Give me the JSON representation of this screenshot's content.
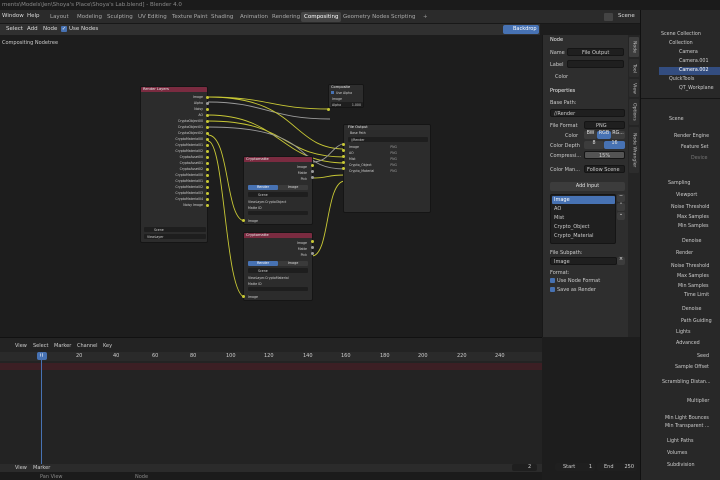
{
  "title_text": "ments\\Models\\Jen\\Shoya's Place\\Shoya's Lab.blend] - Blender 4.0",
  "menu": {
    "window": "Window",
    "help": "Help"
  },
  "workspaces": [
    "Layout",
    "Modeling",
    "Sculpting",
    "UV Editing",
    "Texture Paint",
    "Shading",
    "Animation",
    "Rendering",
    "Compositing",
    "Geometry Nodes",
    "Scripting"
  ],
  "scene_name": "Scene",
  "editor_header": {
    "select": "Select",
    "add": "Add",
    "node": "Node",
    "use_nodes": "Use Nodes",
    "backdrop": "Backdrop",
    "tree_label": "Compositing Nodetree"
  },
  "render_layers": {
    "title": "Render Layers",
    "outputs": [
      "Image",
      "Alpha",
      "Noisy",
      "AO",
      "CryptoObject00",
      "CryptoObject01",
      "CryptoObject02",
      "CryptoMaterial00",
      "CryptoMaterial01",
      "CryptoMaterial02",
      "CryptoAsset00",
      "CryptoAsset01",
      "CryptoAsset02",
      "CryptoMaterial00",
      "CryptoMaterial01",
      "CryptoMaterial02",
      "CryptoMaterial03",
      "CryptoMaterial04",
      "Noisy Image"
    ],
    "scene": "Scene",
    "view_layer": "ViewLayer"
  },
  "composite": {
    "title": "Composite",
    "use_alpha": "Use Alpha",
    "image": "Image",
    "alpha": "Alpha",
    "alpha_val": "1.000"
  },
  "file_output": {
    "title": "File Output",
    "base_path": "Base Path",
    "path_val": "//Render",
    "inputs": [
      "Image",
      "AO",
      "Mist",
      "Crypto_Object",
      "Crypto_Material"
    ],
    "png": "PNG"
  },
  "crypto_obj": {
    "title": "Cryptomatte",
    "outputs": [
      "Image",
      "Matte",
      "Pick"
    ],
    "render": "Render",
    "image_tab": "Image",
    "scene": "Scene",
    "layer": "ViewLayer.CryptoObject",
    "matte_id": "Matte ID",
    "input": "Image"
  },
  "crypto_mat": {
    "title": "Cryptomatte",
    "outputs": [
      "Image",
      "Matte",
      "Pick"
    ],
    "render": "Render",
    "image_tab": "Image",
    "scene": "Scene",
    "layer": "ViewLayer.CryptoMaterial",
    "matte_id": "Matte ID",
    "input": "Image"
  },
  "npanel": {
    "node_header": "Node",
    "name_label": "Name",
    "name_val": "File Output",
    "label_label": "Label",
    "color_label": "Color",
    "props_header": "Properties",
    "base_path_label": "Base Path:",
    "base_path_val": "//Render",
    "file_format_label": "File Format",
    "file_format_val": "PNG",
    "color_label2": "Color",
    "bw": "BW",
    "rgb": "RGB",
    "rgba": "RG...",
    "color_depth_label": "Color Depth",
    "depth_8": "8",
    "depth_16": "16",
    "compression_label": "Compressi...",
    "compression_val": "15%",
    "color_man_label": "Color Man...",
    "color_man_val": "Follow Scene",
    "add_input": "Add Input",
    "inputs": [
      "Image",
      "AO",
      "Mist",
      "Crypto_Object",
      "Crypto_Material"
    ],
    "file_subpath_label": "File Subpath:",
    "file_subpath_val": "Image",
    "format_label": "Format:",
    "use_node_format": "Use Node Format",
    "save_as_render": "Save as Render"
  },
  "side_tabs": [
    "Node",
    "Tool",
    "View",
    "Options",
    "Node Wrangler"
  ],
  "outliner": {
    "scene_collection": "Scene Collection",
    "items": [
      "Collection",
      "Camera",
      "Camera.001",
      "Camera.002",
      "QuickTools",
      "QT_Workplane"
    ]
  },
  "properties": {
    "scene": "Scene",
    "render_engine": "Render Engine",
    "feature_set": "Feature Set",
    "device": "Device",
    "sampling": "Sampling",
    "viewport": "Viewport",
    "noise_threshold": "Noise Threshold",
    "max_samples": "Max Samples",
    "min_samples": "Min Samples",
    "denoise": "Denoise",
    "render": "Render",
    "noise_threshold2": "Noise Threshold",
    "max_samples2": "Max Samples",
    "min_samples2": "Min Samples",
    "time_limit": "Time Limit",
    "denoise2": "Denoise",
    "path_guiding": "Path Guiding",
    "lights": "Lights",
    "advanced": "Advanced",
    "seed": "Seed",
    "sample_offset": "Sample Offset",
    "scrambling": "Scrambling Distan...",
    "multiplier": "Multiplier",
    "min_light_bounces": "Min Light Bounces",
    "min_transparent": "Min Transparent ...",
    "light_paths": "Light Paths",
    "volumes": "Volumes",
    "subdivision": "Subdivision"
  },
  "timeline": {
    "menu": [
      "View",
      "Select",
      "Marker",
      "Channel",
      "Key"
    ],
    "frames": [
      "0",
      "20",
      "40",
      "60",
      "80",
      "100",
      "120",
      "140",
      "160",
      "180",
      "200",
      "220",
      "240"
    ],
    "current": "0",
    "footer": [
      "View",
      "Marker"
    ],
    "frame_val": "2",
    "start_label": "Start",
    "start_val": "1",
    "end_label": "End",
    "end_val": "250",
    "status": [
      "Pan View",
      "Node"
    ]
  },
  "colors": {
    "accent": "#4772b3",
    "orange": "#e68a00",
    "render_layers_header": "#7a2b40",
    "link_yellow": "#c8c835",
    "link_gray": "#9a9a9a",
    "crypto_header": "#7a2b40",
    "output_header": "#2e2e2e"
  }
}
